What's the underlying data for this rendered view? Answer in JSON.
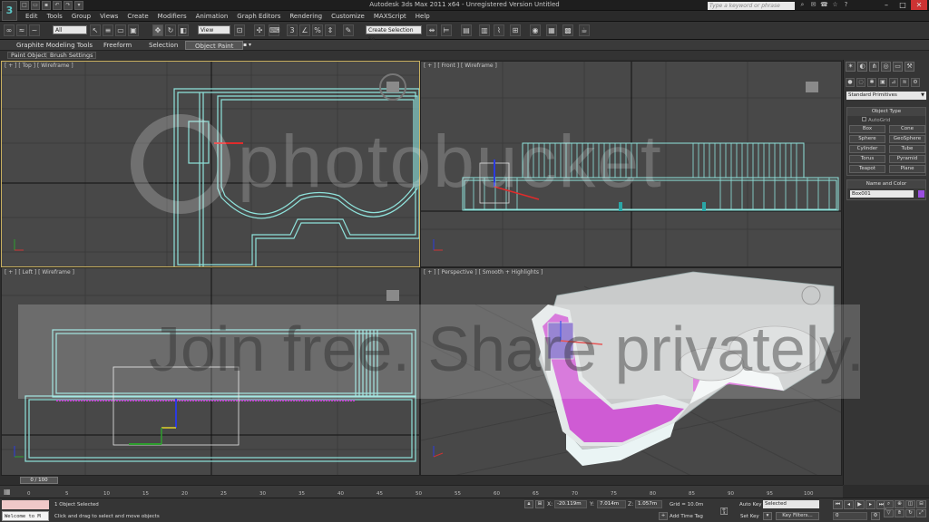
{
  "titlebar": {
    "title": "Autodesk 3ds Max 2011 x64    - Unregistered Version   Untitled",
    "search_placeholder": "Type a keyword or phrase",
    "quick_access": [
      "new",
      "open",
      "save",
      "undo",
      "redo",
      "project"
    ],
    "help_icons": [
      "search-icon",
      "subscription-icon",
      "comm-center-icon",
      "star-icon",
      "help-icon"
    ]
  },
  "menu": [
    "Edit",
    "Tools",
    "Group",
    "Views",
    "Create",
    "Modifiers",
    "Animation",
    "Graph Editors",
    "Rendering",
    "Customize",
    "MAXScript",
    "Help"
  ],
  "toolbar": {
    "selection_filter": "All",
    "ref_coord": "View",
    "named_selection": "Create Selection Se"
  },
  "ribbon": {
    "tabs": [
      "Graphite Modeling Tools",
      "Freeform",
      "Selection",
      "Object Paint"
    ],
    "active_tab": "Object Paint",
    "sub_tabs": [
      "Paint Objects",
      "Brush Settings"
    ]
  },
  "viewports": {
    "top": "[ + ] [ Top ] [ Wireframe ]",
    "front": "[ + ] [ Front ] [ Wireframe ]",
    "left": "[ + ] [ Left ] [ Wireframe ]",
    "perspective": "[ + ] [ Perspective ] [ Smooth + Highlights ]"
  },
  "command_panel": {
    "category": "Standard Primitives",
    "object_type_header": "Object Type",
    "autogrid": "AutoGrid",
    "objects": [
      "Box",
      "Cone",
      "Sphere",
      "GeoSphere",
      "Cylinder",
      "Tube",
      "Torus",
      "Pyramid",
      "Teapot",
      "Plane"
    ],
    "name_color_header": "Name and Color",
    "object_name": "Box001",
    "object_color": "#9a4ee0"
  },
  "timeline": {
    "frame_display": "0 / 100",
    "ticks": [
      "0",
      "5",
      "10",
      "15",
      "20",
      "25",
      "30",
      "35",
      "40",
      "45",
      "50",
      "55",
      "60",
      "65",
      "70",
      "75",
      "80",
      "85",
      "90",
      "95",
      "100"
    ]
  },
  "status": {
    "selection_count": "1 Object Selected",
    "prompt": "Click and drag to select and move objects",
    "maxscript_text": "Welcome to M",
    "x_label": "X:",
    "x_value": "-20.119m",
    "y_label": "Y:",
    "y_value": "7.014m",
    "z_label": "Z:",
    "z_value": "1.057m",
    "grid": "Grid = 10.0m",
    "add_time_tag": "Add Time Tag",
    "auto_key": "Auto Key",
    "set_key": "Set Key",
    "key_mode": "Selected",
    "key_filters": "Key Filters...",
    "current_frame": "0"
  },
  "watermark": {
    "brand": "photobucket",
    "tagline": "Join free. Share privately."
  }
}
